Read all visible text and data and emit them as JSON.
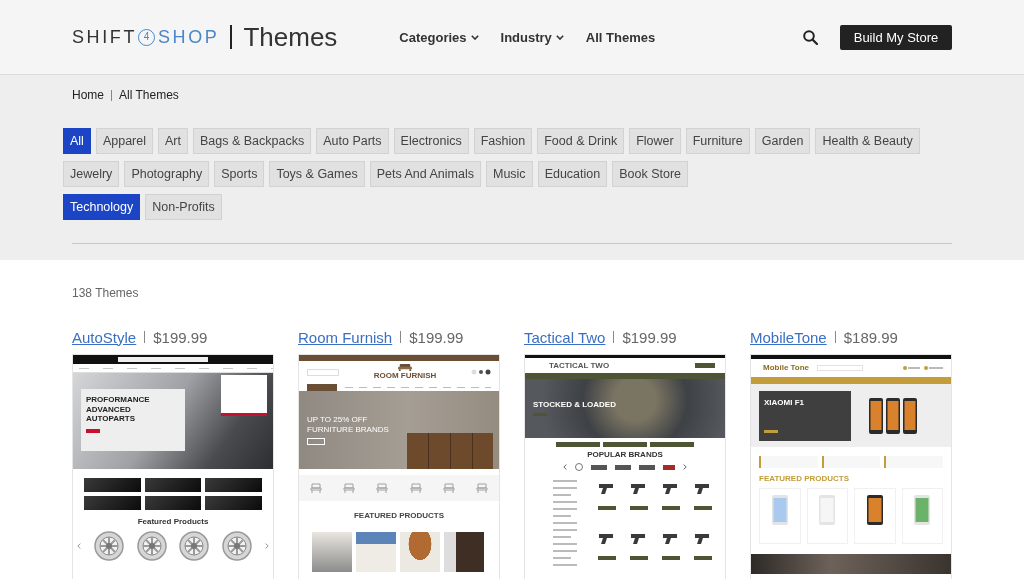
{
  "header": {
    "logo": {
      "left": "SHIFT",
      "mark": "4",
      "right": "SHOP"
    },
    "section_title": "Themes",
    "nav": [
      {
        "label": "Categories",
        "dropdown": true
      },
      {
        "label": "Industry",
        "dropdown": true
      },
      {
        "label": "All Themes",
        "dropdown": false
      }
    ],
    "cta": "Build My Store"
  },
  "breadcrumb": [
    "Home",
    "All Themes"
  ],
  "filter_groups": [
    {
      "chips": [
        {
          "label": "All",
          "selected": true
        },
        {
          "label": "Apparel",
          "selected": false
        },
        {
          "label": "Art",
          "selected": false
        },
        {
          "label": "Bags & Backpacks",
          "selected": false
        },
        {
          "label": "Auto Parts",
          "selected": false
        },
        {
          "label": "Electronics",
          "selected": false
        },
        {
          "label": "Fashion",
          "selected": false
        },
        {
          "label": "Food & Drink",
          "selected": false
        },
        {
          "label": "Flower",
          "selected": false
        },
        {
          "label": "Furniture",
          "selected": false
        },
        {
          "label": "Garden",
          "selected": false
        },
        {
          "label": "Health & Beauty",
          "selected": false
        },
        {
          "label": "Jewelry",
          "selected": false
        },
        {
          "label": "Photography",
          "selected": false
        },
        {
          "label": "Sports",
          "selected": false
        },
        {
          "label": "Toys & Games",
          "selected": false
        },
        {
          "label": "Pets And Animals",
          "selected": false
        },
        {
          "label": "Music",
          "selected": false
        },
        {
          "label": "Education",
          "selected": false
        },
        {
          "label": "Book Store",
          "selected": false
        }
      ]
    },
    {
      "chips": [
        {
          "label": "Technology",
          "selected": true
        },
        {
          "label": "Non-Profits",
          "selected": false
        }
      ]
    }
  ],
  "results_count": "138 Themes",
  "themes": [
    {
      "name": "AutoStyle",
      "price": "$199.99",
      "preview": {
        "kind": "auto",
        "headline": "PROFORMANCE ADVANCED AUTOPARTS",
        "section_title": "Featured Products"
      }
    },
    {
      "name": "Room Furnish",
      "price": "$199.99",
      "preview": {
        "kind": "furniture",
        "logo": "ROOM FURNISH",
        "headline": "UP TO 25% OFF FURNITURE BRANDS",
        "section_title": "FEATURED PRODUCTS"
      }
    },
    {
      "name": "Tactical Two",
      "price": "$199.99",
      "preview": {
        "kind": "tactical",
        "logo": "TACTICAL TWO",
        "headline": "STOCKED & LOADED",
        "section_title": "POPULAR BRANDS"
      }
    },
    {
      "name": "MobileTone",
      "price": "$189.99",
      "preview": {
        "kind": "mobile",
        "logo": "Mobile Tone",
        "headline": "XIAOMI F1",
        "section_title": "FEATURED PRODUCTS"
      }
    }
  ]
}
